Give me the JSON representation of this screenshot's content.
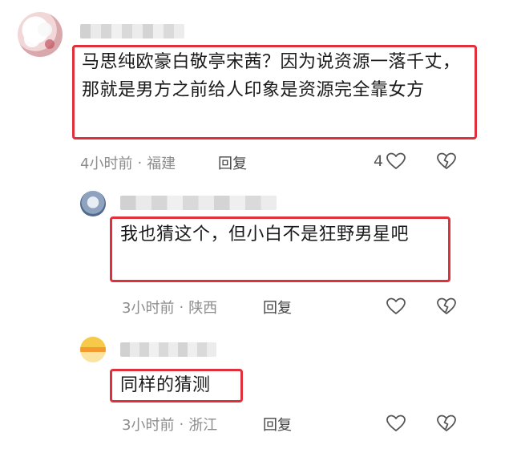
{
  "comments": [
    {
      "text": "马思纯欧豪白敬亭宋茜？因为说资源一落千丈，那就是男方之前给人印象是资源完全靠女方",
      "time": "4小时前",
      "separator": "·",
      "location": "福建",
      "reply_label": "回复",
      "like_count": "4"
    },
    {
      "text": "我也猜这个，但小白不是狂野男星吧",
      "time": "3小时前",
      "separator": "·",
      "location": "陕西",
      "reply_label": "回复",
      "like_count": ""
    },
    {
      "text": "同样的猜测",
      "time": "3小时前",
      "separator": "·",
      "location": "浙江",
      "reply_label": "回复",
      "like_count": ""
    }
  ],
  "colors": {
    "highlight": "#e0303c",
    "meta_text": "#8c8c8c"
  },
  "icons": {
    "like": "heart-outline-icon",
    "dislike": "broken-heart-icon"
  }
}
